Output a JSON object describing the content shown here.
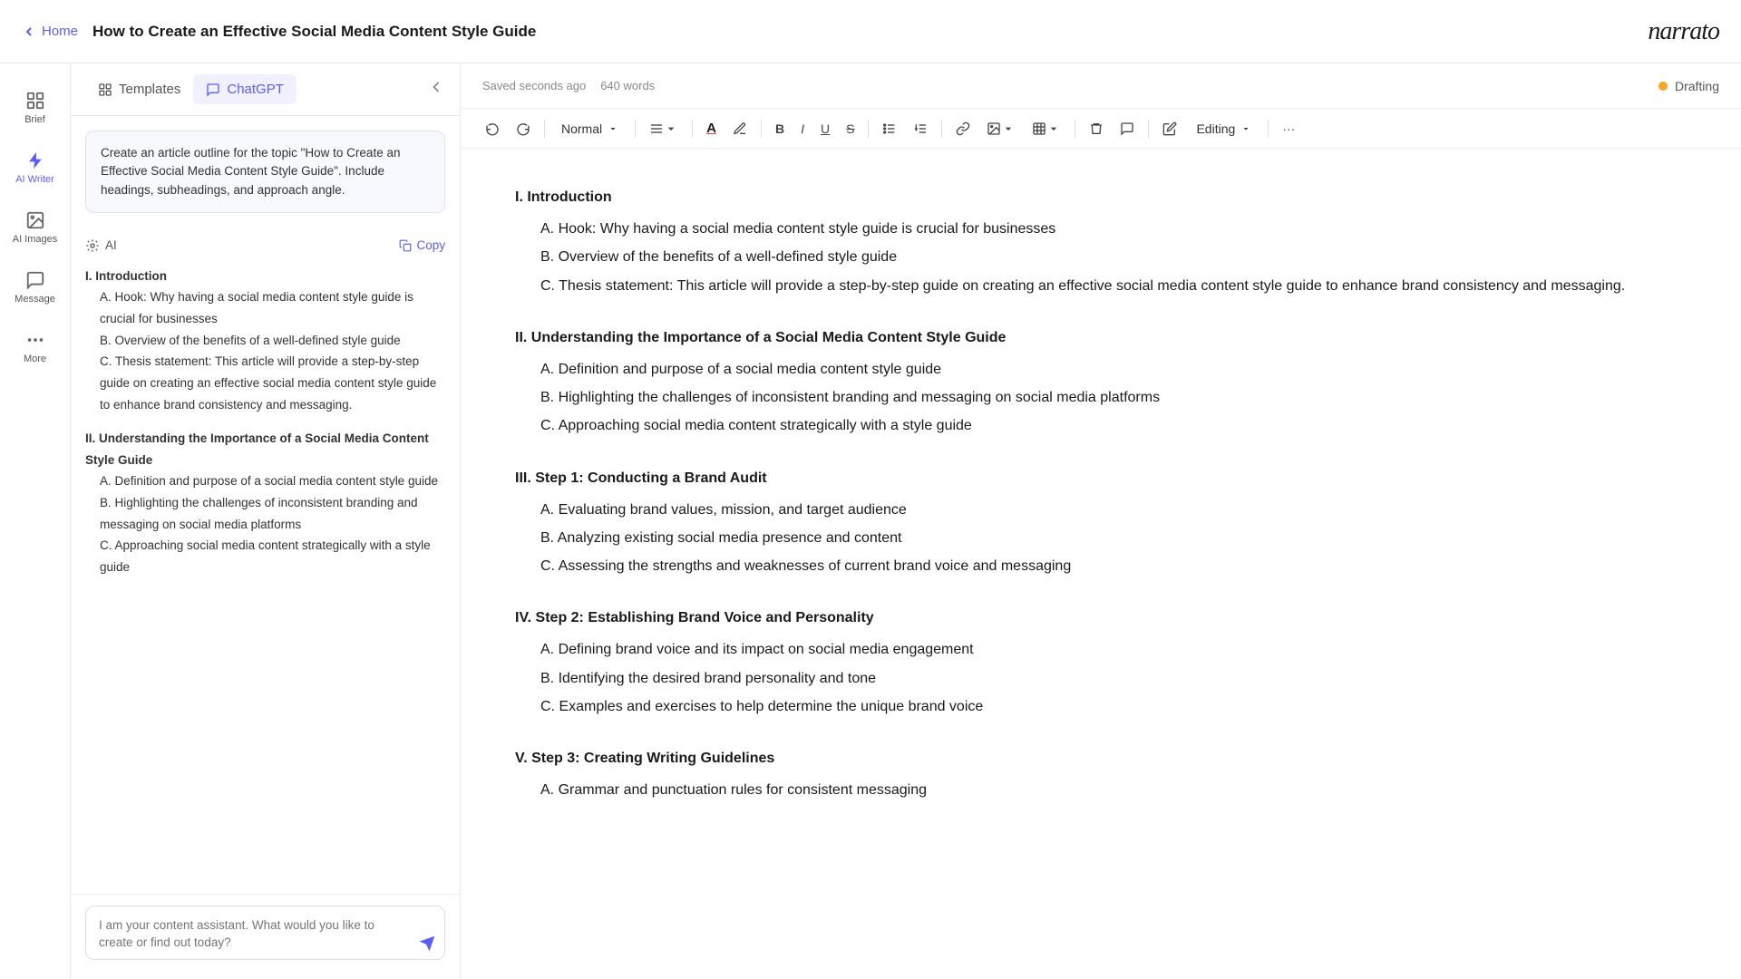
{
  "topbar": {
    "home_label": "Home",
    "page_title": "How to Create an Effective Social Media Content Style Guide",
    "logo": "narrato"
  },
  "sidebar": {
    "items": [
      {
        "id": "brief",
        "label": "Brief",
        "icon": "grid-icon"
      },
      {
        "id": "ai-writer",
        "label": "AI Writer",
        "icon": "bolt-icon"
      },
      {
        "id": "ai-images",
        "label": "AI Images",
        "icon": "image-icon"
      },
      {
        "id": "message",
        "label": "Message",
        "icon": "chat-icon"
      },
      {
        "id": "more",
        "label": "More",
        "icon": "dots-icon"
      }
    ]
  },
  "panel": {
    "tabs": [
      {
        "id": "templates",
        "label": "Templates",
        "icon": "grid-icon"
      },
      {
        "id": "chatgpt",
        "label": "ChatGPT",
        "icon": "chat-icon"
      }
    ],
    "active_tab": "chatgpt",
    "prompt_text": "Create an article outline for the topic \"How to Create an Effective Social Media Content Style Guide\". Include headings, subheadings, and approach angle.",
    "ai_label": "AI",
    "copy_label": "Copy",
    "outline": [
      {
        "text": "I. Introduction",
        "level": 0
      },
      {
        "text": "A. Hook: Why having a social media content style guide is crucial for businesses",
        "level": 1
      },
      {
        "text": "B. Overview of the benefits of a well-defined style guide",
        "level": 1
      },
      {
        "text": "C. Thesis statement: This article will provide a step-by-step guide on creating an effective social media content style guide to enhance brand consistency and messaging.",
        "level": 1
      },
      {
        "text": "II. Understanding the Importance of a Social Media Content Style Guide",
        "level": 0
      },
      {
        "text": "A. Definition and purpose of a social media content style guide",
        "level": 1
      },
      {
        "text": "B. Highlighting the challenges of inconsistent branding and messaging on social media platforms",
        "level": 1
      },
      {
        "text": "C. Approaching social media content strategically with a style guide",
        "level": 1
      }
    ],
    "chat_placeholder": "I am your content assistant. What would you like to create or find out today?"
  },
  "editor": {
    "saved_text": "Saved seconds ago",
    "word_count": "640 words",
    "status": "Drafting",
    "toolbar": {
      "undo_label": "↩",
      "redo_label": "↪",
      "normal_label": "Normal",
      "align_label": "≡",
      "text_color_label": "A",
      "highlight_label": "✏",
      "bold_label": "B",
      "italic_label": "I",
      "underline_label": "U",
      "strikethrough_label": "S",
      "bullet_label": "≡",
      "numbered_label": "≡",
      "link_label": "🔗",
      "image_label": "⊞",
      "table_label": "⊞",
      "clear_label": "✕",
      "comment_label": "💬",
      "editing_label": "Editing",
      "more_label": "..."
    },
    "content": {
      "sections": [
        {
          "heading": "I. Introduction",
          "items": [
            "A. Hook: Why having a social media content style guide is crucial for businesses",
            "B. Overview of the benefits of a well-defined style guide",
            "C. Thesis statement: This article will provide a step-by-step guide on creating an effective social media content style guide to enhance brand consistency and messaging."
          ]
        },
        {
          "heading": "II. Understanding the Importance of a Social Media Content Style Guide",
          "items": [
            "A. Definition and purpose of a social media content style guide",
            "B. Highlighting the challenges of inconsistent branding and messaging on social media platforms",
            "C. Approaching social media content strategically with a style guide"
          ]
        },
        {
          "heading": "III. Step 1: Conducting a Brand Audit",
          "items": [
            "A. Evaluating brand values, mission, and target audience",
            "B. Analyzing existing social media presence and content",
            "C. Assessing the strengths and weaknesses of current brand voice and messaging"
          ]
        },
        {
          "heading": "IV. Step 2: Establishing Brand Voice and Personality",
          "items": [
            "A. Defining brand voice and its impact on social media engagement",
            "B. Identifying the desired brand personality and tone",
            "C. Examples and exercises to help determine the unique brand voice"
          ]
        },
        {
          "heading": "V. Step 3: Creating Writing Guidelines",
          "items": [
            "A. Grammar and punctuation rules for consistent messaging"
          ]
        }
      ]
    }
  }
}
